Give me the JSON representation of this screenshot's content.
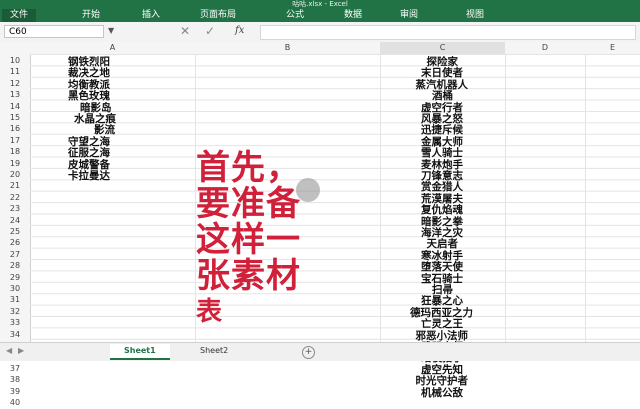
{
  "app": {
    "title": "咕咕.xlsx - Excel"
  },
  "ribbon_tabs": [
    "文件",
    "开始",
    "插入",
    "页面布局",
    "公式",
    "数据",
    "审阅",
    "视图"
  ],
  "formula_bar": {
    "name_box": "C60",
    "fx": "fx",
    "value": ""
  },
  "columns": [
    "A",
    "B",
    "C",
    "D",
    "E"
  ],
  "rows": [
    "10",
    "11",
    "12",
    "13",
    "14",
    "15",
    "16",
    "17",
    "18",
    "19",
    "20",
    "21",
    "22",
    "23",
    "24",
    "25",
    "26",
    "27",
    "28",
    "29",
    "30",
    "31",
    "32",
    "33",
    "34",
    "35",
    "36",
    "37",
    "38",
    "39",
    "40"
  ],
  "col_a": [
    "钢铁烈阳",
    "裁决之地",
    "均衡教派",
    "黑色玫瑰",
    "暗影岛",
    "水晶之痕",
    "影流",
    "守望之海",
    "征服之海",
    "皮城警备",
    "卡拉曼达"
  ],
  "col_c": [
    "探险家",
    "末日使者",
    "蒸汽机器人",
    "酒桶",
    "虚空行者",
    "风暴之怒",
    "迅捷斥候",
    "金属大师",
    "雪人骑士",
    "麦林炮手",
    "刀锋意志",
    "赏金猎人",
    "荒漠屠夫",
    "复仇焰魂",
    "暗影之拳",
    "海洋之灾",
    "天启者",
    "寒冰射手",
    "堕落天使",
    "宝石骑士",
    "扫帚",
    "狂暴之心",
    "德玛西亚之力",
    "亡灵之王",
    "邪恶小法师",
    "武器大师",
    "暗夜猎手",
    "虚空先知",
    "时光守护者",
    "机械公敌"
  ],
  "overlay_lines": [
    "首先，",
    "要准备",
    "这样一",
    "张素材",
    "表"
  ],
  "sheets": [
    "Sheet1",
    "Sheet2"
  ],
  "active_sheet": "Sheet1",
  "add_sheet": "+",
  "colors": {
    "accent": "#217346",
    "overlay": "#d0203a"
  }
}
